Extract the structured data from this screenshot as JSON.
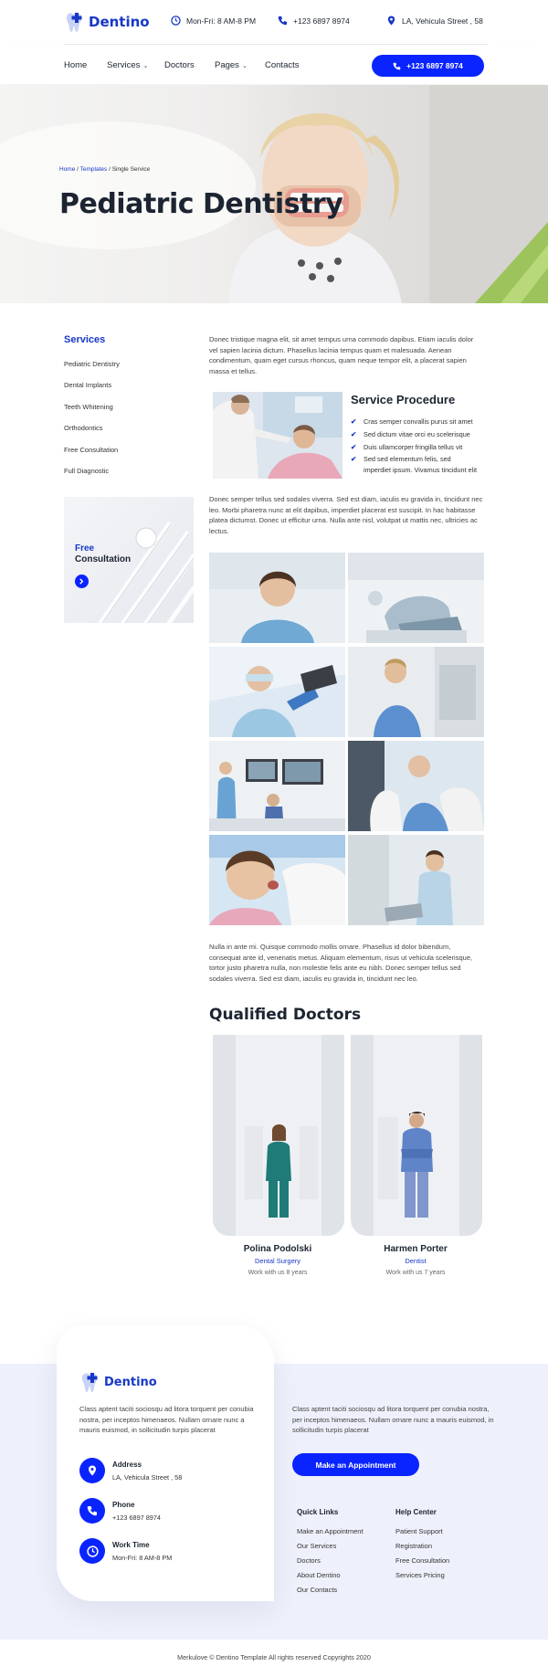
{
  "brand": {
    "name": "Dentino",
    "primary": "#0a24ff",
    "dark": "#1c2431"
  },
  "topbar": {
    "hours": "Mon-Fri: 8 AM-8 PM",
    "phone": "+123 6897 8974",
    "address": "LA, Vehicula Street , 58"
  },
  "nav": {
    "items": [
      "Home",
      "Services",
      "Doctors",
      "Pages",
      "Contacts"
    ],
    "call_button": "+123 6897 8974"
  },
  "hero": {
    "breadcrumb": {
      "home": "Home",
      "templates": "Templates",
      "current": "Single Service"
    },
    "title": "Pediatric Dentistry"
  },
  "sidebar": {
    "title": "Services",
    "items": [
      "Pediatric Dentistry",
      "Dental Implants",
      "Teeth Whitening",
      "Orthodontics",
      "Free Consultation",
      "Full Diagnostic"
    ],
    "promo": {
      "line1": "Free",
      "line2": "Consultation"
    }
  },
  "content": {
    "intro": "Donec tristique magna elit, sit amet tempus urna commodo dapibus. Etiam iaculis dolor vel sapien lacinia dictum. Phasellus lacinia tempus quam et malesuada. Aenean condimentum, quam eget cursus rhoncus, quam neque tempor elit, a placerat sapien massa et tellus.",
    "procedure": {
      "title": "Service Procedure",
      "items": [
        "Cras semper convallis purus sit amet",
        "Sed dictum vitae orci eu scelerisque",
        "Duis ullamcorper fringilla tellus vit",
        "Sed sed elementum felis, sed",
        "imperdiet ipsum. Vivamus tincidunt elit"
      ]
    },
    "para2": "Donec semper tellus sed sodales viverra. Sed est diam, iaculis eu gravida in, tincidunt nec leo. Morbi pharetra nunc at elit dapibus, imperdiet placerat est suscipit. In hac habitasse platea dictumst. Donec ut efficitur urna. Nulla ante nisl, volutpat ut mattis nec, ultricies ac lectus.",
    "para3": "Nulla in ante mi. Quisque commodo mollis ornare. Phasellus id dolor bibendum, consequat ante id, venenatis metus. Aliquam elementum, risus ut vehicula scelerisque, tortor justo pharetra nulla, non molestie felis ante eu nibh. Donec semper tellus sed sodales viverra. Sed est diam, iaculis eu gravida in, tincidunt nec leo."
  },
  "doctors": {
    "title": "Qualified Doctors",
    "list": [
      {
        "name": "Polina Podolski",
        "role": "Dental Surgery",
        "work": "Work with us 8 years"
      },
      {
        "name": "Harmen Porter",
        "role": "Dentist",
        "work": "Work with us 7 years"
      }
    ]
  },
  "footer": {
    "brand": "Dentino",
    "desc": "Class aptent taciti sociosqu ad litora torquent per conubia nostra, per inceptos himenaeos. Nullam ornare nunc a mauris euismod, in sollicitudin turpis placerat",
    "contacts": [
      {
        "label": "Address",
        "value": "LA, Vehicula Street , 58"
      },
      {
        "label": "Phone",
        "value": "+123 6897 8974"
      },
      {
        "label": "Work Time",
        "value": "Mon-Fri: 8 AM-8 PM"
      }
    ],
    "right_desc": "Class aptent taciti sociosqu ad litora torquent per conubia nostra, per inceptos himenaeos. Nullam ornare nunc a mauris euismod, in sollicitudin turpis placerat",
    "appointment_button": "Make an Appointment",
    "quick_links": {
      "title": "Quick Links",
      "items": [
        "Make an Appointment",
        "Our Services",
        "Doctors",
        "About Dentino",
        "Our Contacts"
      ]
    },
    "help_center": {
      "title": "Help Center",
      "items": [
        "Patient Support",
        "Registration",
        "Free Consultation",
        "Services Pricing"
      ]
    },
    "copyright": "Merkulove © Dentino Template All rights reserved Copyrights 2020"
  }
}
